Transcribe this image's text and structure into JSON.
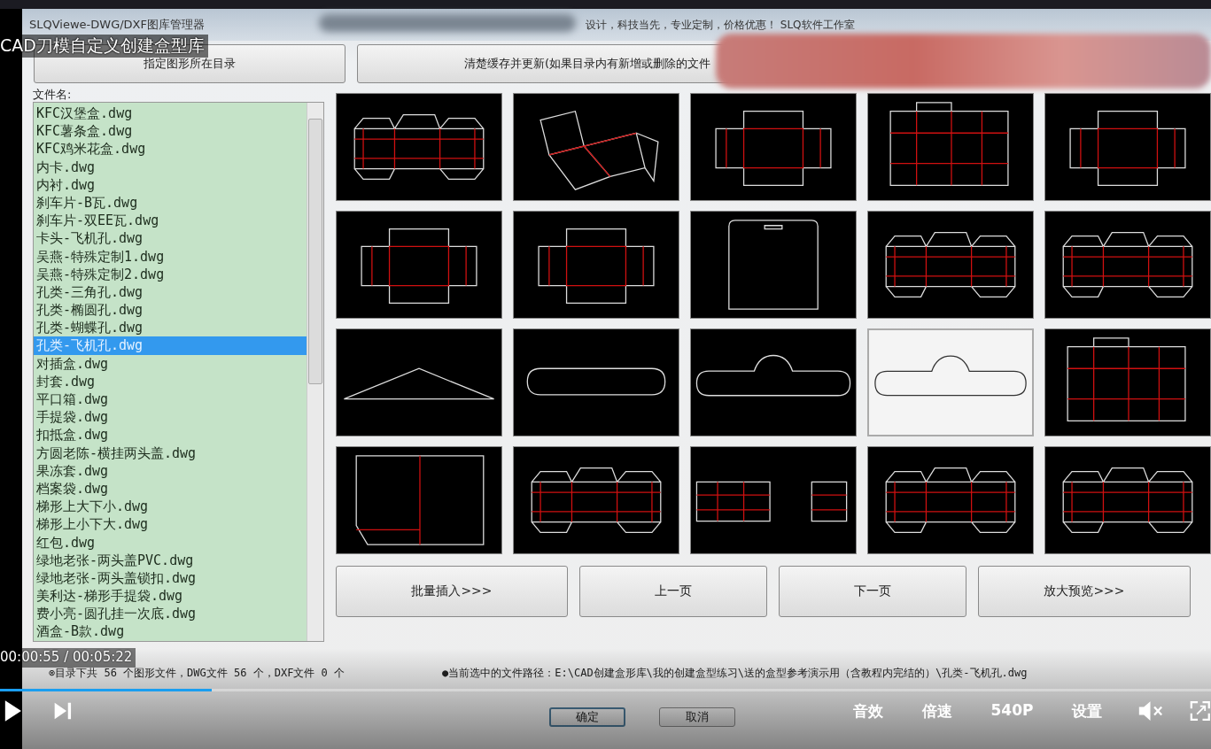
{
  "window": {
    "title": "SLQViewe-DWG/DXF图库管理器",
    "tagline": "设计，科技当先，专业定制，价格优惠！ SLQ软件工作室"
  },
  "top_buttons": [
    {
      "label": "指定图形所在目录"
    },
    {
      "label": "清楚缓存并更新(如果目录内有新增或删除的文件"
    }
  ],
  "file_list": {
    "label": "文件名:",
    "items": [
      {
        "name": "KFC汉堡盒.dwg",
        "selected": false
      },
      {
        "name": "KFC薯条盒.dwg",
        "selected": false
      },
      {
        "name": "KFC鸡米花盒.dwg",
        "selected": false
      },
      {
        "name": "内卡.dwg",
        "selected": false
      },
      {
        "name": "内衬.dwg",
        "selected": false
      },
      {
        "name": "刹车片-B瓦.dwg",
        "selected": false
      },
      {
        "name": "刹车片-双EE瓦.dwg",
        "selected": false
      },
      {
        "name": "卡头-飞机孔.dwg",
        "selected": false
      },
      {
        "name": "吴燕-特殊定制1.dwg",
        "selected": false
      },
      {
        "name": "吴燕-特殊定制2.dwg",
        "selected": false
      },
      {
        "name": "孔类-三角孔.dwg",
        "selected": false
      },
      {
        "name": "孔类-椭圆孔.dwg",
        "selected": false
      },
      {
        "name": "孔类-蝴蝶孔.dwg",
        "selected": false
      },
      {
        "name": "孔类-飞机孔.dwg",
        "selected": true
      },
      {
        "name": "对插盒.dwg",
        "selected": false
      },
      {
        "name": "封套.dwg",
        "selected": false
      },
      {
        "name": "平口箱.dwg",
        "selected": false
      },
      {
        "name": "手提袋.dwg",
        "selected": false
      },
      {
        "name": "扣抵盒.dwg",
        "selected": false
      },
      {
        "name": "方圆老陈-横挂两头盖.dwg",
        "selected": false
      },
      {
        "name": "果冻套.dwg",
        "selected": false
      },
      {
        "name": "档案袋.dwg",
        "selected": false
      },
      {
        "name": "梯形上大下小.dwg",
        "selected": false
      },
      {
        "name": "梯形上小下大.dwg",
        "selected": false
      },
      {
        "name": "红包.dwg",
        "selected": false
      },
      {
        "name": "绿地老张-两头盖PVC.dwg",
        "selected": false
      },
      {
        "name": "绿地老张-两头盖锁扣.dwg",
        "selected": false
      },
      {
        "name": "美利达-梯形手提袋.dwg",
        "selected": false
      },
      {
        "name": "费小亮-圆孔挂一次底.dwg",
        "selected": false
      },
      {
        "name": "酒盒-B款.dwg",
        "selected": false
      }
    ]
  },
  "thumbnails": [
    {
      "kind": "carton",
      "selected": false
    },
    {
      "kind": "tilted",
      "selected": false
    },
    {
      "kind": "tray",
      "selected": false
    },
    {
      "kind": "sleeve",
      "selected": false
    },
    {
      "kind": "tray",
      "selected": false
    },
    {
      "kind": "tray",
      "selected": false
    },
    {
      "kind": "tray",
      "selected": false
    },
    {
      "kind": "card",
      "selected": false
    },
    {
      "kind": "carton",
      "selected": false
    },
    {
      "kind": "carton",
      "selected": false
    },
    {
      "kind": "triangle",
      "selected": false
    },
    {
      "kind": "capsule",
      "selected": false
    },
    {
      "kind": "hanger",
      "selected": false
    },
    {
      "kind": "hanger",
      "selected": true
    },
    {
      "kind": "sleeve",
      "selected": false
    },
    {
      "kind": "folder",
      "selected": false
    },
    {
      "kind": "carton",
      "selected": false
    },
    {
      "kind": "pair",
      "selected": false
    },
    {
      "kind": "carton",
      "selected": false
    },
    {
      "kind": "carton",
      "selected": false
    }
  ],
  "grid_buttons": [
    {
      "label": "批量插入>>>"
    },
    {
      "label": "上一页"
    },
    {
      "label": "下一页"
    },
    {
      "label": "放大预览>>>"
    }
  ],
  "status": {
    "count": "⊗目录下共 56 个图形文件，DWG文件 56 个，DXF文件 0 个",
    "path": "●当前选中的文件路径：E:\\CAD创建盒形库\\我的创建盒型练习\\送的盒型参考演示用（含教程内完结的）\\孔类-飞机孔.dwg"
  },
  "dialog_buttons": [
    {
      "label": "确定"
    },
    {
      "label": "取消"
    }
  ],
  "player": {
    "video_title": "CAD刀模自定义创建盒型库",
    "time": "00:00:55 / 00:05:22",
    "level": 0.175,
    "options": [
      "音效",
      "倍速",
      "540P",
      "设置"
    ]
  }
}
